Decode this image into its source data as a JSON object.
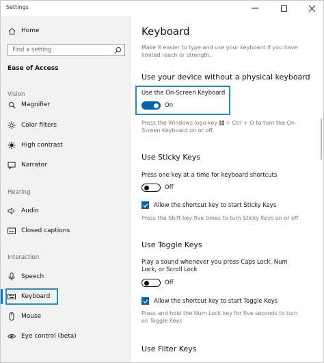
{
  "window": {
    "title": "Settings"
  },
  "sidebar": {
    "home": "Home",
    "search_placeholder": "Find a setting",
    "category": "Ease of Access",
    "sections": {
      "vision": "Vision",
      "hearing": "Hearing",
      "interaction": "Interaction"
    },
    "items": {
      "magnifier": "Magnifier",
      "color_filters": "Color filters",
      "high_contrast": "High contrast",
      "narrator": "Narrator",
      "audio": "Audio",
      "closed_captions": "Closed captions",
      "speech": "Speech",
      "keyboard": "Keyboard",
      "mouse": "Mouse",
      "eye_control": "Eye control (beta)"
    }
  },
  "main": {
    "title": "Keyboard",
    "intro": "Make it easier to type and use your keyboard if you have limited reach or strength.",
    "osk": {
      "heading": "Use your device without a physical keyboard",
      "label": "Use the On-Screen Keyboard",
      "state": "On",
      "desc_pre": "Press the Windows logo key",
      "desc_post": "+ Ctrl + O to turn the On-Screen Keyboard on or off."
    },
    "sticky": {
      "heading": "Use Sticky Keys",
      "label": "Press one key at a time for keyboard shortcuts",
      "state": "Off",
      "check_label": "Allow the shortcut key to start Sticky Keys",
      "desc": "Press the Shift key five times to turn Sticky Keys on or off"
    },
    "toggle_keys": {
      "heading": "Use Toggle Keys",
      "label": "Play a sound whenever you press Caps Lock, Num Lock, or Scroll Lock",
      "state": "Off",
      "check_label": "Allow the shortcut key to start Toggle Keys",
      "desc": "Press and hold the Num Lock key for five seconds to turn on Toggle Keys"
    },
    "filter": {
      "heading": "Use Filter Keys"
    }
  },
  "colors": {
    "accent": "#0063b1",
    "highlight": "#1e90c8"
  },
  "icons": [
    "home-icon",
    "search-icon",
    "magnifier-icon",
    "color-filters-icon",
    "high-contrast-icon",
    "narrator-icon",
    "audio-icon",
    "closed-captions-icon",
    "speech-icon",
    "keyboard-icon",
    "mouse-icon",
    "eye-control-icon",
    "windows-logo-icon",
    "minimize-icon",
    "maximize-icon",
    "close-icon"
  ]
}
